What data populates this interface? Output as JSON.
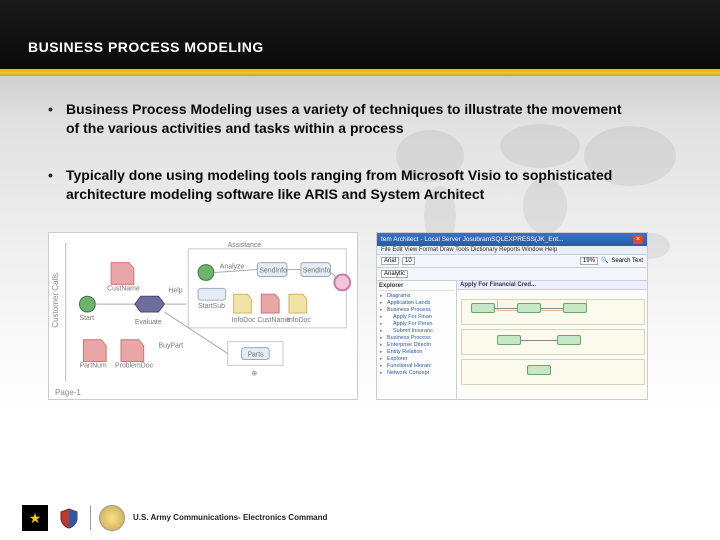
{
  "header": {
    "title": "BUSINESS PROCESS MODELING"
  },
  "bullets": [
    "Business Process Modeling uses a variety of techniques to illustrate the movement of the various activities and tasks within a process",
    "Typically done using modeling tools ranging from Microsoft Visio to sophisticated architecture modeling software like ARIS and System Architect"
  ],
  "visio": {
    "ylabel": "Customer Calls",
    "page_label": "Page-1",
    "nodes": {
      "start": "Start",
      "custname": "CustName",
      "evaluate": "Evaluate",
      "help": "Help",
      "partnum": "PartNum",
      "problemdoc": "ProblemDoc",
      "buypart": "BuyPart",
      "assistance": "Assistance",
      "analyze": "Analyze",
      "startsub": "StartSub",
      "infodoc": "InfoDoc",
      "custname2": "CustName",
      "infodoc2": "InfoDoc",
      "sendinfo": "SendInfo",
      "sendinfo2": "SendInfo",
      "parts": "Parts"
    }
  },
  "system_architect": {
    "title": "tem Architect - Local Server JosubramSQLEXPRESS(JK_Ent...",
    "menu": "File Edit View Format Draw Tools Dictionary Reports Window Help",
    "toolbar": {
      "font": "Arial",
      "size": "10",
      "zoom": "19%",
      "tool": "Search Text"
    },
    "explorer_title": "Explorer",
    "tab": "Analytic",
    "canvas_title": "Apply For Financial Cred...",
    "tree": [
      "Diagrams",
      "Application Lands",
      "Business Process",
      "Apply For Finan",
      "Apply For Persn",
      "Submit Insuranc",
      "Business Process",
      "Enterprise Directn",
      "Entity Relation",
      "Explorer",
      "Functional Hierarc",
      "Network Concept"
    ]
  },
  "footer": {
    "org": "U.S. Army Communications-\nElectronics Command"
  }
}
